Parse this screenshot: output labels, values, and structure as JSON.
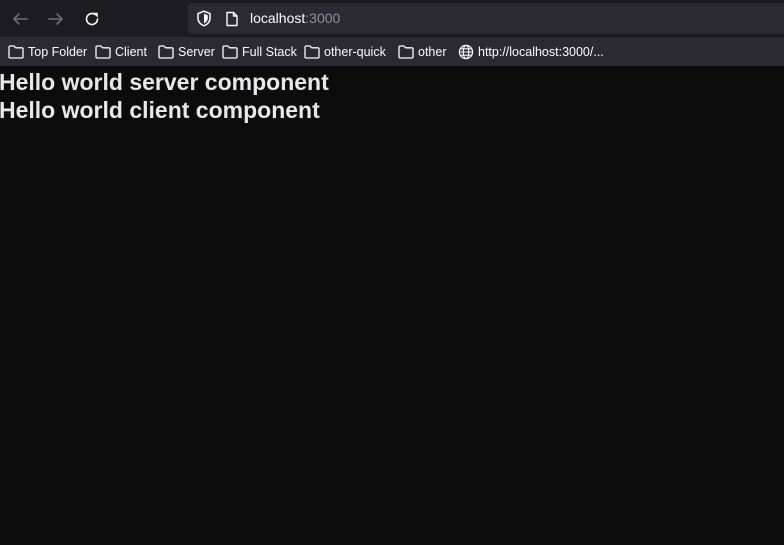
{
  "navbar": {
    "back_icon": "arrow-left-icon",
    "forward_icon": "arrow-right-icon",
    "reload_icon": "reload-icon",
    "url_host": "localhost",
    "url_port": ":3000"
  },
  "bookmarks": [
    {
      "label": "Top Folder",
      "icon": "folder-icon"
    },
    {
      "label": "Client",
      "icon": "folder-icon"
    },
    {
      "label": "Server",
      "icon": "folder-icon"
    },
    {
      "label": "Full Stack",
      "icon": "folder-icon"
    },
    {
      "label": "other-quick",
      "icon": "folder-icon"
    },
    {
      "label": "other",
      "icon": "folder-icon"
    },
    {
      "label": "http://localhost:3000/...",
      "icon": "globe-icon"
    }
  ],
  "page": {
    "heading_server": "Hello world server component",
    "heading_client": "Hello world client component"
  },
  "colors": {
    "background": "#0b0b0c",
    "toolbar": "#1c1b22",
    "urlbar": "#2b2a33",
    "text": "#fbfbfe"
  }
}
